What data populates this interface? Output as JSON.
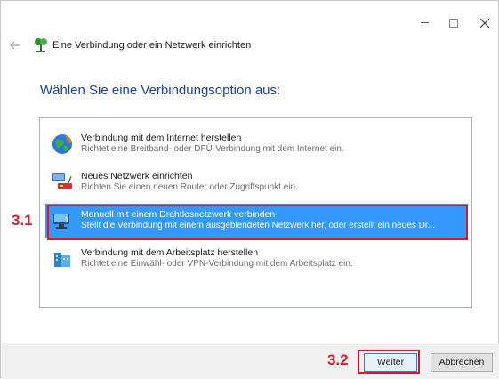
{
  "window": {
    "title": "Eine Verbindung oder ein Netzwerk einrichten",
    "instruction": "Wählen Sie eine Verbindungsoption aus:"
  },
  "options": [
    {
      "title": "Verbindung mit dem Internet herstellen",
      "description": "Richtet eine Breitband- oder DFÜ-Verbindung mit dem Internet ein.",
      "icon": "globe-icon",
      "selected": false
    },
    {
      "title": "Neues Netzwerk einrichten",
      "description": "Richten Sie einen neuen Router oder Zugriffspunkt ein.",
      "icon": "router-icon",
      "selected": false
    },
    {
      "title": "Manuell mit einem Drahtlosnetzwerk verbinden",
      "description": "Stellt die Verbindung mit einem ausgeblendeten Netzwerk her, oder erstellt ein neues Dr...",
      "icon": "wireless-network-icon",
      "selected": true
    },
    {
      "title": "Verbindung mit dem Arbeitsplatz herstellen",
      "description": "Richtet eine Einwähl- oder VPN-Verbindung mit dem Arbeitsplatz ein.",
      "icon": "workplace-icon",
      "selected": false
    }
  ],
  "annotations": {
    "step1": "3.1",
    "step2": "3.2",
    "highlight_color": "#e0142a"
  },
  "buttons": {
    "next": "Weiter",
    "cancel": "Abbrechen"
  },
  "colors": {
    "selection": "#3399ff",
    "instruction": "#1e3f9a"
  }
}
